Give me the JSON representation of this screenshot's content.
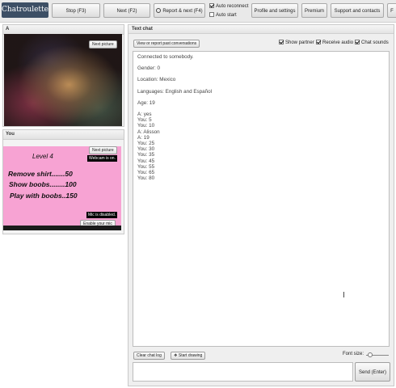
{
  "toolbar": {
    "logo": "Chatroulette",
    "stop": "Stop (F3)",
    "next": "Next (F2)",
    "report_next": "Report & next (F4)",
    "auto_reconnect": "Auto reconnect",
    "auto_start": "Auto start",
    "profile": "Profile and settings",
    "premium": "Premium",
    "support": "Support and contacts",
    "overflow": "F"
  },
  "partner_panel": {
    "title": "A",
    "next_picture": "Next picture"
  },
  "you_panel": {
    "title": "You",
    "next_picture": "Next picture",
    "webcam_status": "Webcam is on.",
    "mic_status": "Mic is disabled.",
    "enable_mic": "Enable your mic",
    "sign": {
      "level": "Level 4",
      "line1": "Remove shirt.......50",
      "line2": "Show boobs........100",
      "line3": "Play with boobs..150"
    }
  },
  "chat": {
    "title": "Text chat",
    "view_report": "View or report past conversations",
    "show_partner": "Show partner",
    "receive_audio": "Receive audio",
    "chat_sounds": "Chat sounds",
    "info": {
      "connected": "Connected to somebody.",
      "gender": "Gender: 0",
      "location": "Location: Mexico",
      "languages": "Languages: English and Español",
      "age": "Age: 19"
    },
    "messages": [
      "A: yes",
      "You: 5",
      "You: 10",
      "A: Alisson",
      "A: 19",
      "You: 25",
      "You: 30",
      "You: 35",
      "You: 45",
      "You: 55",
      "You: 65",
      "You: 80"
    ],
    "clear_log": "Clear chat log",
    "start_drawing": "Start drawing",
    "font_size": "Font size:",
    "send": "Send (Enter)"
  },
  "colors": {
    "logo_bg": "#3d4f65",
    "sign_pink": "#f7a3d3"
  }
}
